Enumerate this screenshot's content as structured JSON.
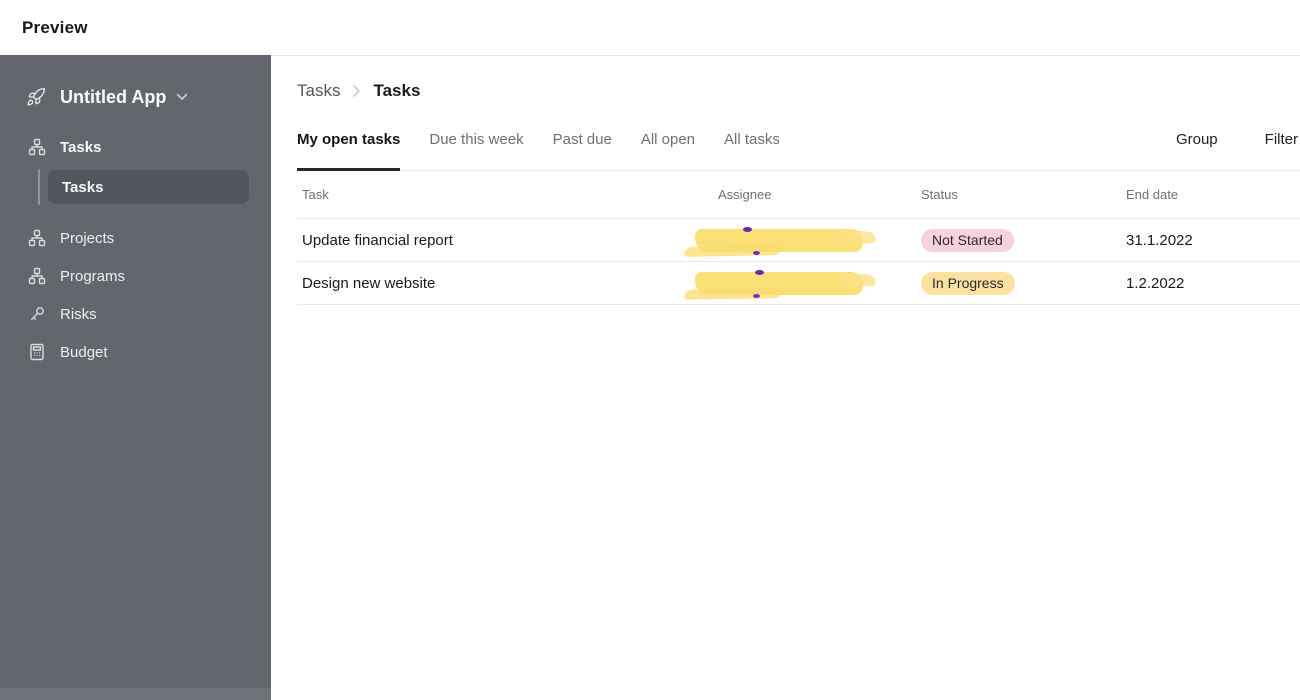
{
  "top_bar": {
    "title": "Preview"
  },
  "sidebar": {
    "app_name": "Untitled App",
    "items": [
      {
        "label": "Tasks",
        "icon": "sitemap-icon"
      },
      {
        "label": "Projects",
        "icon": "sitemap-icon"
      },
      {
        "label": "Programs",
        "icon": "sitemap-icon"
      },
      {
        "label": "Risks",
        "icon": "key-icon"
      },
      {
        "label": "Budget",
        "icon": "calculator-icon"
      }
    ],
    "sub_item": {
      "label": "Tasks",
      "parent": "Tasks",
      "selected": true
    }
  },
  "breadcrumb": {
    "items": [
      "Tasks",
      "Tasks"
    ]
  },
  "tabs": {
    "items": [
      {
        "label": "My open tasks",
        "active": true
      },
      {
        "label": "Due this week",
        "active": false
      },
      {
        "label": "Past due",
        "active": false
      },
      {
        "label": "All open",
        "active": false
      },
      {
        "label": "All tasks",
        "active": false
      }
    ]
  },
  "toolbar": {
    "group": "Group",
    "filter": "Filter"
  },
  "table": {
    "columns": [
      "Task",
      "Assignee",
      "Status",
      "End date"
    ],
    "rows": [
      {
        "task": "Update financial report",
        "assignee_redacted": true,
        "status": "Not Started",
        "status_bg": "#f8d1de",
        "end_date": "31.1.2022"
      },
      {
        "task": "Design new website",
        "assignee_redacted": true,
        "status": "In Progress",
        "status_bg": "#fbe2a3",
        "end_date": "1.2.2022"
      }
    ]
  },
  "colors": {
    "sidebar_bg": "#63666d",
    "sidebar_selected_bg": "#53565e",
    "badge_not_started": "#f8d1de",
    "badge_in_progress": "#fbe2a3",
    "redaction_highlight": "#fbdf77",
    "active_tab_underline": "#26282b"
  }
}
